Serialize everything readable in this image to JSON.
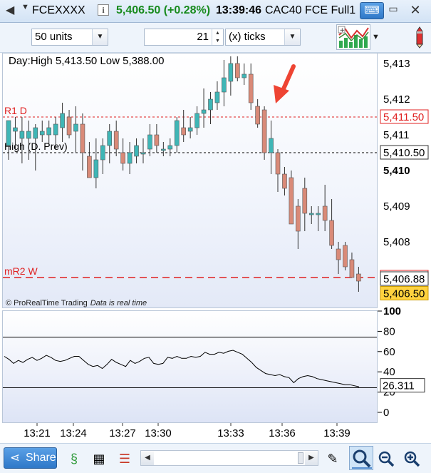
{
  "titlebar": {
    "ticker": "FCEXXXX",
    "price_change": "5,406.50 (+0.28%)",
    "time": "13:39:46",
    "instrument": "CAC40 FCE Full1",
    "icons": [
      "back-arrow-icon",
      "info-icon",
      "keyboard-icon",
      "minimize-icon",
      "close-icon"
    ],
    "price_color": "#178a1d"
  },
  "toolbar": {
    "units_value": "50 units",
    "ticks_count": "21",
    "ticks_unit": "(x) ticks",
    "icons": [
      "chart-type-icon",
      "pen-icon"
    ]
  },
  "chart": {
    "day_label": "Day:High 5,413.50 Low 5,388.00",
    "copyright": "© ProRealTime Trading",
    "realtime": "Data is real time",
    "colors": {
      "up": "#3fb6b6",
      "down": "#d98a78",
      "resistance": "#e02020",
      "indicator_line": "#000000"
    },
    "levels": [
      {
        "name": "R1 D",
        "value": "5,411.50",
        "color": "#e02020"
      },
      {
        "name": "High (D. Prev)",
        "value": "5,410.50",
        "color": "#000000"
      },
      {
        "name": "mR2 W",
        "value": "5,407.00",
        "color": "#e02020"
      }
    ],
    "last_price": "5,406.88",
    "current_price": "5,406.50",
    "price_ticks": [
      "5,413",
      "5,412",
      "5,411",
      "5,410",
      "5,409",
      "5,408"
    ],
    "indicator_value": "26.311",
    "indicator_ticks": [
      "100",
      "80",
      "60",
      "40",
      "20",
      "0"
    ],
    "time_ticks": [
      "13:21",
      "13:24",
      "13:27",
      "13:30",
      "13:33",
      "13:36",
      "13:39"
    ]
  },
  "bottombar": {
    "share_label": "Share",
    "icons": [
      "share-icon",
      "indicator-icon",
      "table-icon",
      "compare-icon",
      "scroll-left-icon",
      "scroll-right-icon",
      "pen-tools-icon",
      "zoom-select-icon",
      "zoom-out-icon",
      "zoom-in-icon"
    ]
  },
  "chart_data": {
    "type": "candlestick",
    "ylim": [
      5405.8,
      5413.3
    ],
    "x_ticks": [
      "13:21",
      "13:24",
      "13:27",
      "13:30",
      "13:33",
      "13:36",
      "13:39"
    ],
    "candles": [
      {
        "o": 5410.7,
        "h": 5411.4,
        "l": 5410.3,
        "c": 5411.4
      },
      {
        "o": 5411.1,
        "h": 5411.5,
        "l": 5410.6,
        "c": 5411.2
      },
      {
        "o": 5410.9,
        "h": 5411.5,
        "l": 5410.2,
        "c": 5411.1
      },
      {
        "o": 5410.9,
        "h": 5411.4,
        "l": 5410.3,
        "c": 5411.1
      },
      {
        "o": 5410.9,
        "h": 5411.3,
        "l": 5410.0,
        "c": 5411.2
      },
      {
        "o": 5411.0,
        "h": 5411.4,
        "l": 5410.8,
        "c": 5411.1
      },
      {
        "o": 5411.0,
        "h": 5411.4,
        "l": 5410.7,
        "c": 5411.2
      },
      {
        "o": 5411.0,
        "h": 5411.5,
        "l": 5410.6,
        "c": 5411.3
      },
      {
        "o": 5411.2,
        "h": 5411.9,
        "l": 5410.8,
        "c": 5411.6
      },
      {
        "o": 5411.5,
        "h": 5411.7,
        "l": 5410.9,
        "c": 5411.0
      },
      {
        "o": 5411.1,
        "h": 5411.8,
        "l": 5410.5,
        "c": 5411.3
      },
      {
        "o": 5411.3,
        "h": 5411.6,
        "l": 5410.0,
        "c": 5410.5
      },
      {
        "o": 5410.4,
        "h": 5410.8,
        "l": 5409.8,
        "c": 5409.8
      },
      {
        "o": 5409.8,
        "h": 5410.9,
        "l": 5409.5,
        "c": 5410.3
      },
      {
        "o": 5410.3,
        "h": 5410.9,
        "l": 5409.9,
        "c": 5410.7
      },
      {
        "o": 5410.7,
        "h": 5411.3,
        "l": 5410.2,
        "c": 5411.1
      },
      {
        "o": 5411.1,
        "h": 5411.4,
        "l": 5410.4,
        "c": 5410.6
      },
      {
        "o": 5410.5,
        "h": 5410.9,
        "l": 5410.0,
        "c": 5410.2
      },
      {
        "o": 5410.2,
        "h": 5410.8,
        "l": 5409.9,
        "c": 5410.5
      },
      {
        "o": 5410.4,
        "h": 5410.9,
        "l": 5410.2,
        "c": 5410.7
      },
      {
        "o": 5410.5,
        "h": 5410.9,
        "l": 5410.2,
        "c": 5410.5
      },
      {
        "o": 5410.6,
        "h": 5411.3,
        "l": 5410.4,
        "c": 5411.0
      },
      {
        "o": 5411.0,
        "h": 5411.3,
        "l": 5410.5,
        "c": 5410.7
      },
      {
        "o": 5410.6,
        "h": 5410.8,
        "l": 5410.4,
        "c": 5410.6
      },
      {
        "o": 5410.6,
        "h": 5410.9,
        "l": 5410.4,
        "c": 5410.7
      },
      {
        "o": 5410.7,
        "h": 5411.5,
        "l": 5410.5,
        "c": 5411.4
      },
      {
        "o": 5411.2,
        "h": 5411.7,
        "l": 5410.8,
        "c": 5411.0
      },
      {
        "o": 5411.1,
        "h": 5411.5,
        "l": 5410.9,
        "c": 5411.2
      },
      {
        "o": 5411.2,
        "h": 5411.8,
        "l": 5411.0,
        "c": 5411.6
      },
      {
        "o": 5411.6,
        "h": 5412.3,
        "l": 5411.2,
        "c": 5411.7
      },
      {
        "o": 5411.7,
        "h": 5412.2,
        "l": 5411.3,
        "c": 5412.0
      },
      {
        "o": 5411.9,
        "h": 5412.5,
        "l": 5411.7,
        "c": 5412.2
      },
      {
        "o": 5412.2,
        "h": 5413.1,
        "l": 5411.8,
        "c": 5412.6
      },
      {
        "o": 5412.5,
        "h": 5413.2,
        "l": 5412.1,
        "c": 5413.0
      },
      {
        "o": 5413.0,
        "h": 5413.2,
        "l": 5412.5,
        "c": 5412.6
      },
      {
        "o": 5412.6,
        "h": 5413.0,
        "l": 5412.4,
        "c": 5412.7
      },
      {
        "o": 5412.7,
        "h": 5413.0,
        "l": 5411.7,
        "c": 5411.9
      },
      {
        "o": 5411.8,
        "h": 5412.0,
        "l": 5411.2,
        "c": 5411.3
      },
      {
        "o": 5411.7,
        "h": 5411.8,
        "l": 5410.3,
        "c": 5410.5
      },
      {
        "o": 5410.5,
        "h": 5411.4,
        "l": 5409.9,
        "c": 5410.9
      },
      {
        "o": 5410.5,
        "h": 5410.6,
        "l": 5409.4,
        "c": 5409.9
      },
      {
        "o": 5409.9,
        "h": 5410.1,
        "l": 5409.3,
        "c": 5409.5
      },
      {
        "o": 5409.8,
        "h": 5410.0,
        "l": 5408.5,
        "c": 5408.5
      },
      {
        "o": 5409.0,
        "h": 5409.2,
        "l": 5407.8,
        "c": 5408.3
      },
      {
        "o": 5409.5,
        "h": 5409.8,
        "l": 5408.3,
        "c": 5408.8
      },
      {
        "o": 5408.8,
        "h": 5409.0,
        "l": 5408.5,
        "c": 5408.8
      },
      {
        "o": 5408.8,
        "h": 5409.0,
        "l": 5408.3,
        "c": 5408.8
      },
      {
        "o": 5409.0,
        "h": 5409.6,
        "l": 5408.3,
        "c": 5408.6
      },
      {
        "o": 5408.6,
        "h": 5409.2,
        "l": 5407.8,
        "c": 5407.9
      },
      {
        "o": 5407.8,
        "h": 5408.0,
        "l": 5407.1,
        "c": 5407.5
      },
      {
        "o": 5407.9,
        "h": 5408.0,
        "l": 5407.2,
        "c": 5407.3
      },
      {
        "o": 5407.5,
        "h": 5407.7,
        "l": 5407.0,
        "c": 5407.0
      },
      {
        "o": 5407.1,
        "h": 5407.3,
        "l": 5406.6,
        "c": 5406.9
      }
    ],
    "indicator": {
      "ylim": [
        0,
        100
      ],
      "levels": [
        75,
        25
      ],
      "values": [
        56,
        53,
        49,
        52,
        50,
        53,
        55,
        52,
        54,
        57,
        55,
        52,
        51,
        52,
        54,
        56,
        56,
        52,
        48,
        46,
        47,
        44,
        48,
        53,
        50,
        48,
        46,
        52,
        49,
        51,
        54,
        55,
        49,
        48,
        49,
        55,
        54,
        56,
        54,
        54,
        56,
        55,
        56,
        60,
        58,
        58,
        60,
        59,
        61,
        62,
        60,
        58,
        54,
        50,
        45,
        42,
        39,
        38,
        37,
        38,
        36,
        35,
        30,
        34,
        36,
        37,
        36,
        34,
        33,
        32,
        31,
        30,
        29,
        28,
        28,
        27,
        26
      ]
    }
  }
}
